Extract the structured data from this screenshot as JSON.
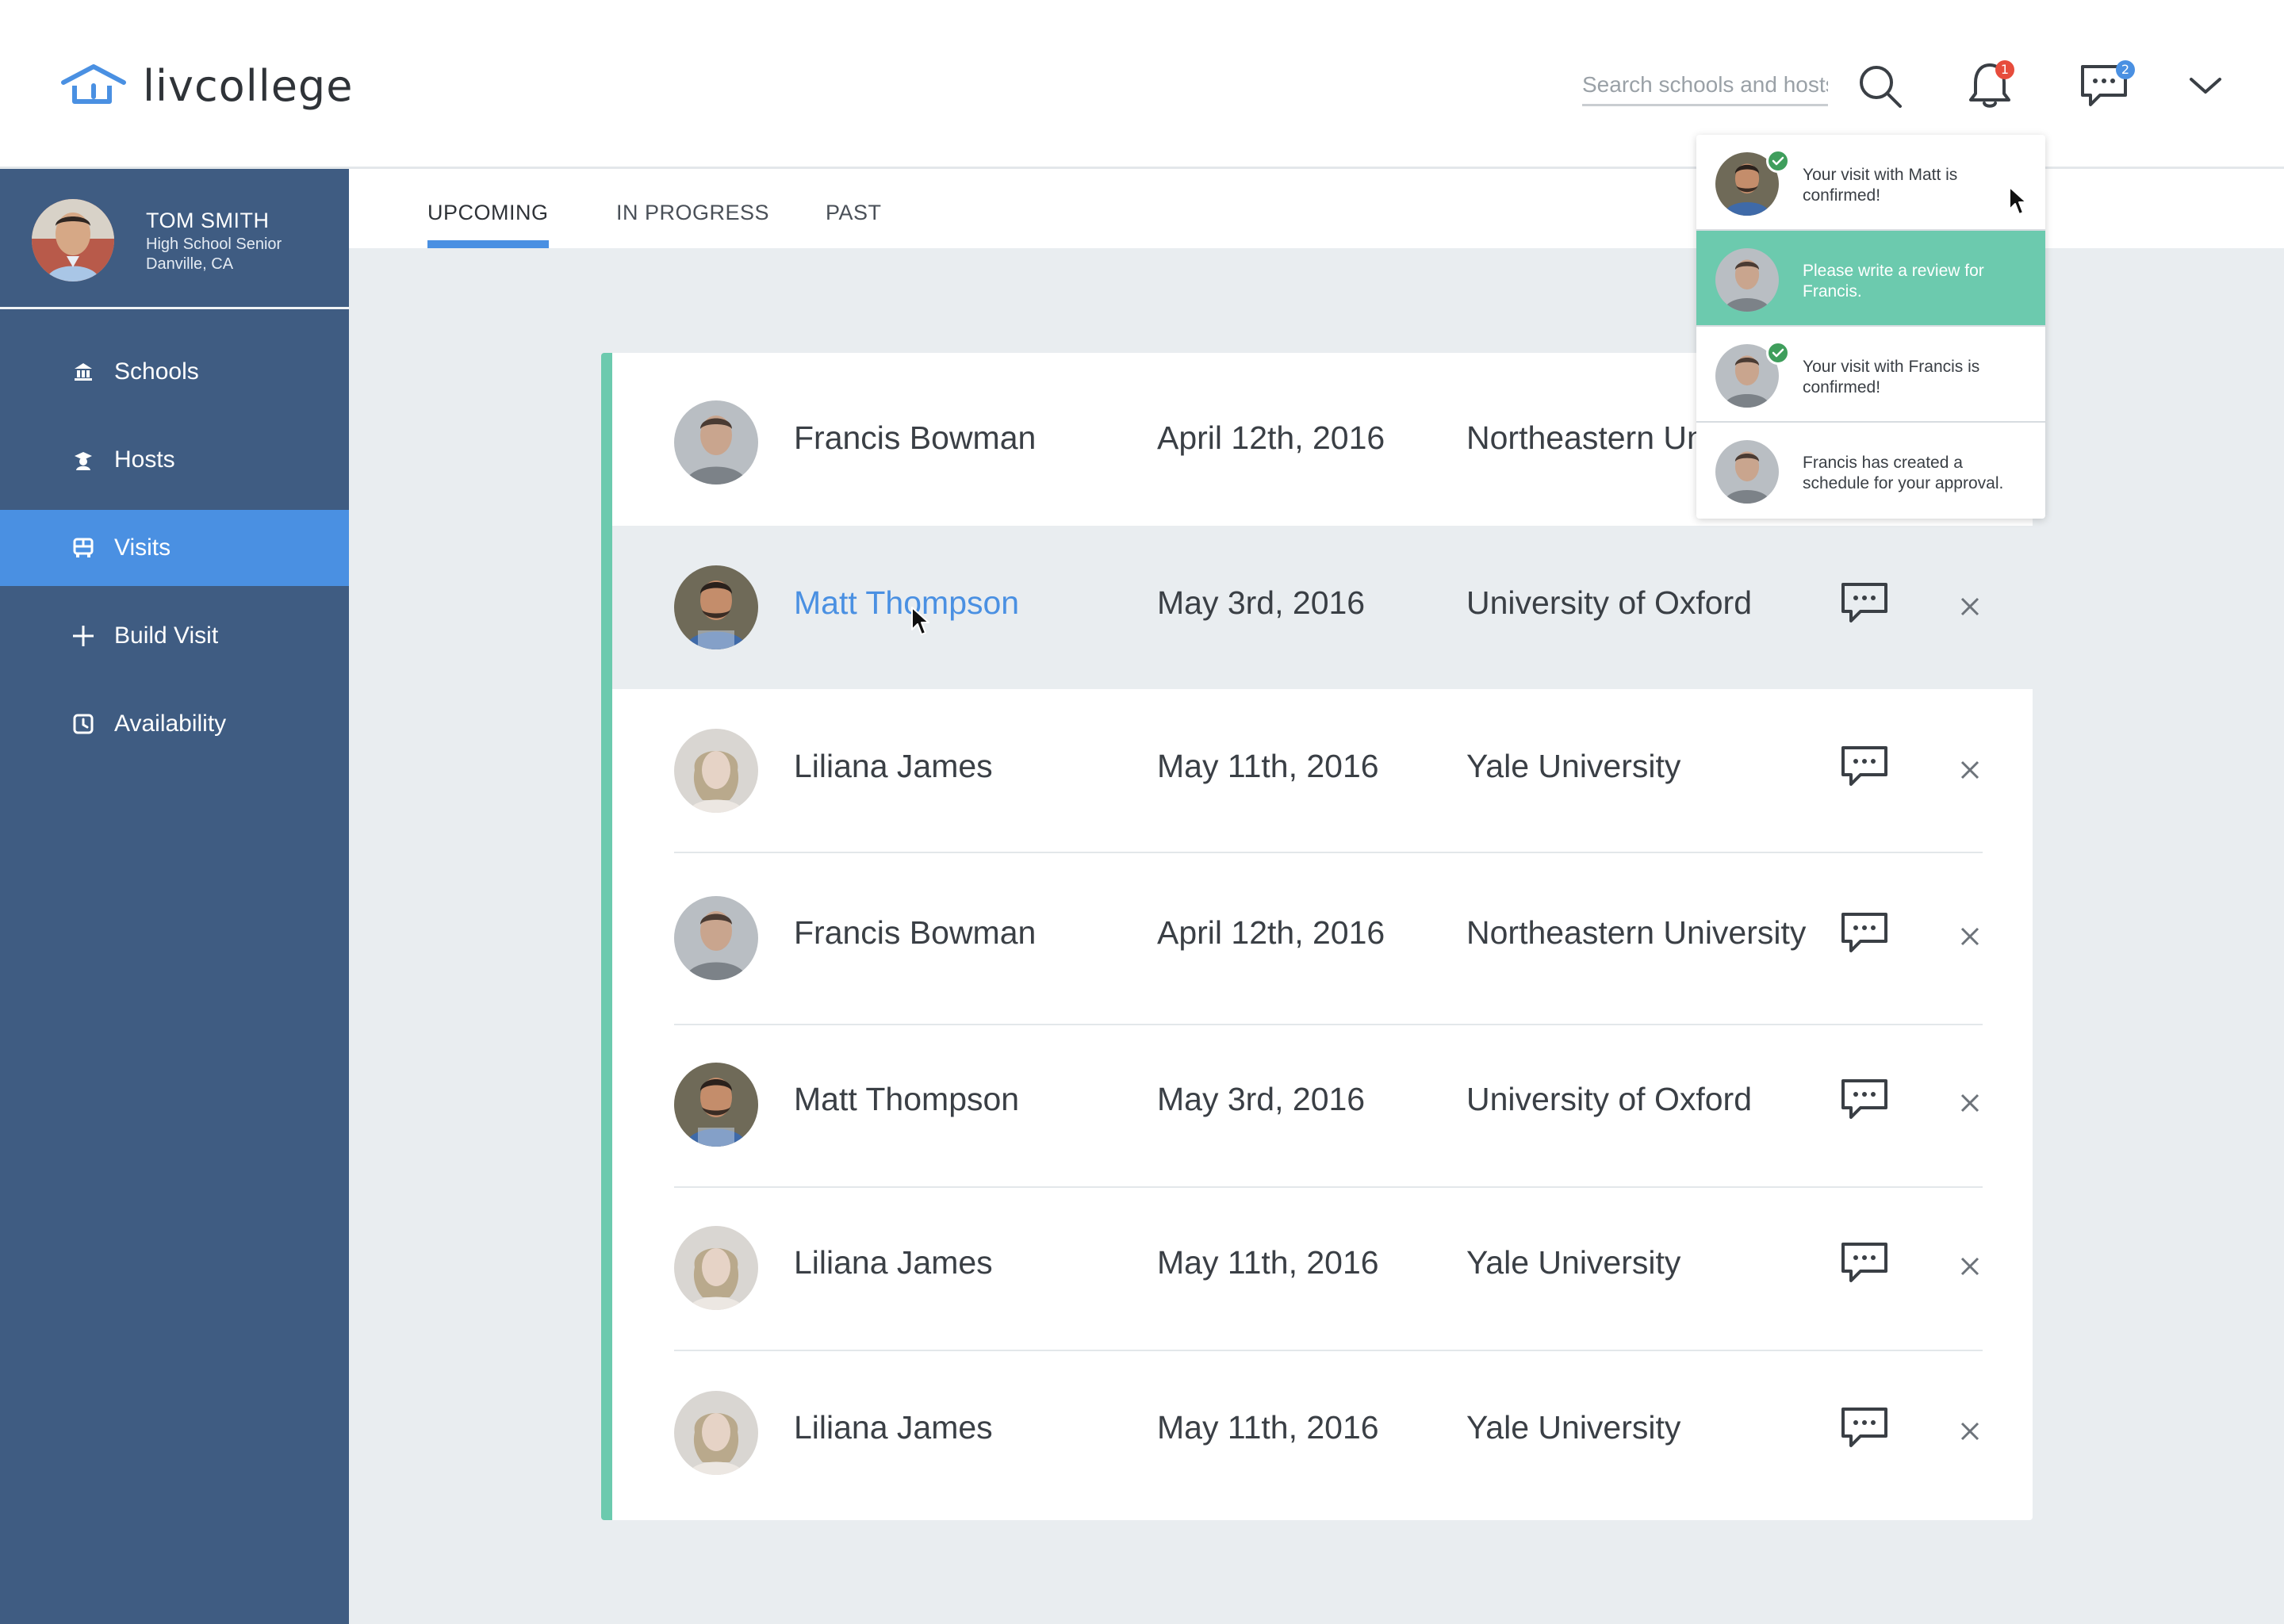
{
  "app": {
    "name": "livcollege"
  },
  "header": {
    "search_placeholder": "Search schools and hosts",
    "notifications_count": "1",
    "messages_count": "2"
  },
  "profile": {
    "name": "TOM SMITH",
    "role": "High School Senior",
    "location": "Danville, CA"
  },
  "sidebar": {
    "items": [
      {
        "label": "Schools",
        "icon": "bank-icon"
      },
      {
        "label": "Hosts",
        "icon": "graduate-icon"
      },
      {
        "label": "Visits",
        "icon": "bus-icon",
        "active": true
      },
      {
        "label": "Build Visit",
        "icon": "plus-icon"
      },
      {
        "label": "Availability",
        "icon": "clock-icon"
      }
    ]
  },
  "tabs": [
    {
      "label": "UPCOMING",
      "active": true
    },
    {
      "label": "IN PROGRESS"
    },
    {
      "label": "PAST"
    }
  ],
  "visits": [
    {
      "host": "Francis Bowman",
      "date": "April 12th, 2016",
      "school": "Northeastern University",
      "avatar": "francis"
    },
    {
      "host": "Matt Thompson",
      "date": "May 3rd, 2016",
      "school": "University of Oxford",
      "avatar": "matt",
      "hovered": true
    },
    {
      "host": "Liliana James",
      "date": "May 11th, 2016",
      "school": "Yale University",
      "avatar": "liliana"
    },
    {
      "host": "Francis Bowman",
      "date": "April 12th, 2016",
      "school": "Northeastern University",
      "avatar": "francis"
    },
    {
      "host": "Matt Thompson",
      "date": "May 3rd, 2016",
      "school": "University of Oxford",
      "avatar": "matt"
    },
    {
      "host": "Liliana James",
      "date": "May 11th, 2016",
      "school": "Yale University",
      "avatar": "liliana"
    },
    {
      "host": "Liliana James",
      "date": "May 11th, 2016",
      "school": "Yale University",
      "avatar": "liliana"
    }
  ],
  "notifications": [
    {
      "text": "Your visit with Matt is confirmed!",
      "avatar": "matt",
      "check": true
    },
    {
      "text": "Please write a review for Francis.",
      "avatar": "francis",
      "active": true
    },
    {
      "text": "Your visit with Francis is confirmed!",
      "avatar": "francis",
      "check": true
    },
    {
      "text": "Francis has created a schedule for your approval.",
      "avatar": "francis"
    }
  ],
  "colors": {
    "accent": "#4a90e2",
    "sidebar": "#3f5c82",
    "teal": "#6ccaae",
    "badge_red": "#e74c3c",
    "badge_blue": "#4a90e2"
  }
}
